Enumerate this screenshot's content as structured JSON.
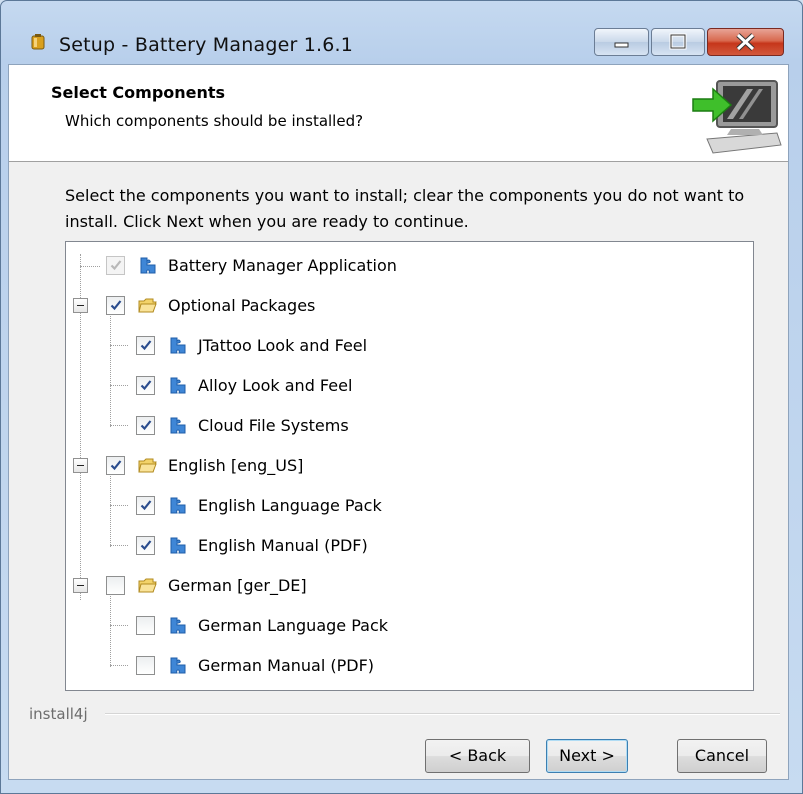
{
  "window": {
    "title": "Setup - Battery Manager 1.6.1"
  },
  "header": {
    "title": "Select Components",
    "subtitle": "Which components should be installed?"
  },
  "intro_text": "Select the components you want to install; clear the components you do not want to install. Click Next when you are ready to continue.",
  "components": [
    {
      "label": "Battery Manager Application",
      "checked": true,
      "disabled": true,
      "icon": "component-icon",
      "level": 0
    },
    {
      "label": "Optional Packages",
      "checked": true,
      "disabled": false,
      "icon": "folder-icon",
      "level": 0,
      "expandable": true
    },
    {
      "label": "JTattoo Look and Feel",
      "checked": true,
      "disabled": false,
      "icon": "component-icon",
      "level": 1
    },
    {
      "label": "Alloy Look and Feel",
      "checked": true,
      "disabled": false,
      "icon": "component-icon",
      "level": 1
    },
    {
      "label": "Cloud File Systems",
      "checked": true,
      "disabled": false,
      "icon": "component-icon",
      "level": 1
    },
    {
      "label": "English [eng_US]",
      "checked": true,
      "disabled": false,
      "icon": "folder-icon",
      "level": 0,
      "expandable": true
    },
    {
      "label": "English Language Pack",
      "checked": true,
      "disabled": false,
      "icon": "component-icon",
      "level": 1
    },
    {
      "label": "English Manual (PDF)",
      "checked": true,
      "disabled": false,
      "icon": "component-icon",
      "level": 1
    },
    {
      "label": "German [ger_DE]",
      "checked": false,
      "disabled": false,
      "icon": "folder-icon",
      "level": 0,
      "expandable": true
    },
    {
      "label": "German Language Pack",
      "checked": false,
      "disabled": false,
      "icon": "component-icon",
      "level": 1
    },
    {
      "label": "German Manual (PDF)",
      "checked": false,
      "disabled": false,
      "icon": "component-icon",
      "level": 1
    }
  ],
  "footer": {
    "brand": "install4j",
    "back_label": "< Back",
    "next_label": "Next >",
    "cancel_label": "Cancel"
  },
  "colors": {
    "check": "#2b4d8e",
    "component_icon": "#3f86d6",
    "folder_icon": "#f3d36a"
  }
}
